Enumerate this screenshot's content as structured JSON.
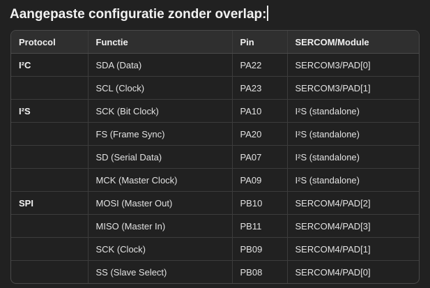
{
  "heading": "Aangepaste configuratie zonder overlap:",
  "table": {
    "headers": [
      "Protocol",
      "Functie",
      "Pin",
      "SERCOM/Module"
    ],
    "rows": [
      {
        "protocol": "I²C",
        "function": "SDA (Data)",
        "pin": "PA22",
        "module": "SERCOM3/PAD[0]"
      },
      {
        "protocol": "",
        "function": "SCL (Clock)",
        "pin": "PA23",
        "module": "SERCOM3/PAD[1]"
      },
      {
        "protocol": "I²S",
        "function": "SCK (Bit Clock)",
        "pin": "PA10",
        "module": "I²S (standalone)"
      },
      {
        "protocol": "",
        "function": "FS (Frame Sync)",
        "pin": "PA20",
        "module": "I²S (standalone)"
      },
      {
        "protocol": "",
        "function": "SD (Serial Data)",
        "pin": "PA07",
        "module": "I²S (standalone)"
      },
      {
        "protocol": "",
        "function": "MCK (Master Clock)",
        "pin": "PA09",
        "module": "I²S (standalone)"
      },
      {
        "protocol": "SPI",
        "function": "MOSI (Master Out)",
        "pin": "PB10",
        "module": "SERCOM4/PAD[2]"
      },
      {
        "protocol": "",
        "function": "MISO (Master In)",
        "pin": "PB11",
        "module": "SERCOM4/PAD[3]"
      },
      {
        "protocol": "",
        "function": "SCK (Clock)",
        "pin": "PB09",
        "module": "SERCOM4/PAD[1]"
      },
      {
        "protocol": "",
        "function": "SS (Slave Select)",
        "pin": "PB08",
        "module": "SERCOM4/PAD[0]"
      }
    ]
  }
}
